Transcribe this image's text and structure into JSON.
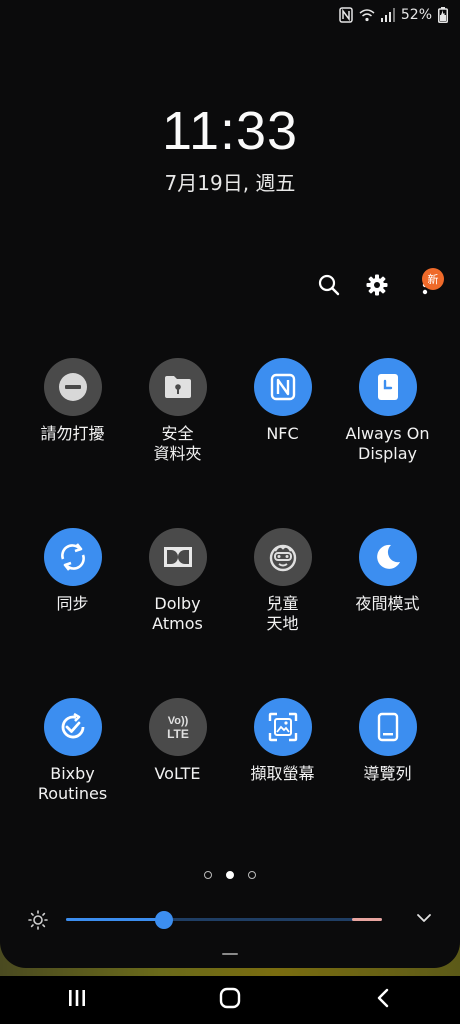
{
  "status": {
    "battery_percent": "52%",
    "icons": [
      "nfc-icon",
      "wifi-icon",
      "signal-icon",
      "battery-icon"
    ]
  },
  "lock": {
    "time": "11:33",
    "date": "7月19日, 週五"
  },
  "top_actions": {
    "icons": [
      "search-icon",
      "gear-icon",
      "more-vertical-icon"
    ],
    "badge": "新"
  },
  "tiles": [
    {
      "label": "請勿打擾",
      "icon": "do-not-disturb-icon",
      "state": "off"
    },
    {
      "label": "安全\n資料夾",
      "icon": "secure-folder-icon",
      "state": "off"
    },
    {
      "label": "NFC",
      "icon": "nfc-icon",
      "state": "on"
    },
    {
      "label": "Always On\nDisplay",
      "icon": "always-on-display-icon",
      "state": "on"
    },
    {
      "label": "同步",
      "icon": "sync-icon",
      "state": "on"
    },
    {
      "label": "Dolby\nAtmos",
      "icon": "dolby-icon",
      "state": "off"
    },
    {
      "label": "兒童\n天地",
      "icon": "kids-icon",
      "state": "off"
    },
    {
      "label": "夜間模式",
      "icon": "night-mode-icon",
      "state": "on"
    },
    {
      "label": "Bixby\nRoutines",
      "icon": "bixby-routines-icon",
      "state": "on"
    },
    {
      "label": "VoLTE",
      "icon": "volte-icon",
      "state": "off",
      "glyph_top": "Vo))",
      "glyph_bottom": "LTE"
    },
    {
      "label": "擷取螢幕",
      "icon": "screenshot-icon",
      "state": "on"
    },
    {
      "label": "導覽列",
      "icon": "navigation-bar-icon",
      "state": "on"
    }
  ],
  "pager": {
    "count": 3,
    "active": 1
  },
  "brightness": {
    "level_percent": 31
  },
  "colors": {
    "accent": "#3c8ef0",
    "tile_off": "#4a4a4a",
    "badge": "#ef6a2a"
  },
  "nav": {
    "icons": [
      "recents-icon",
      "home-icon",
      "back-icon"
    ]
  }
}
